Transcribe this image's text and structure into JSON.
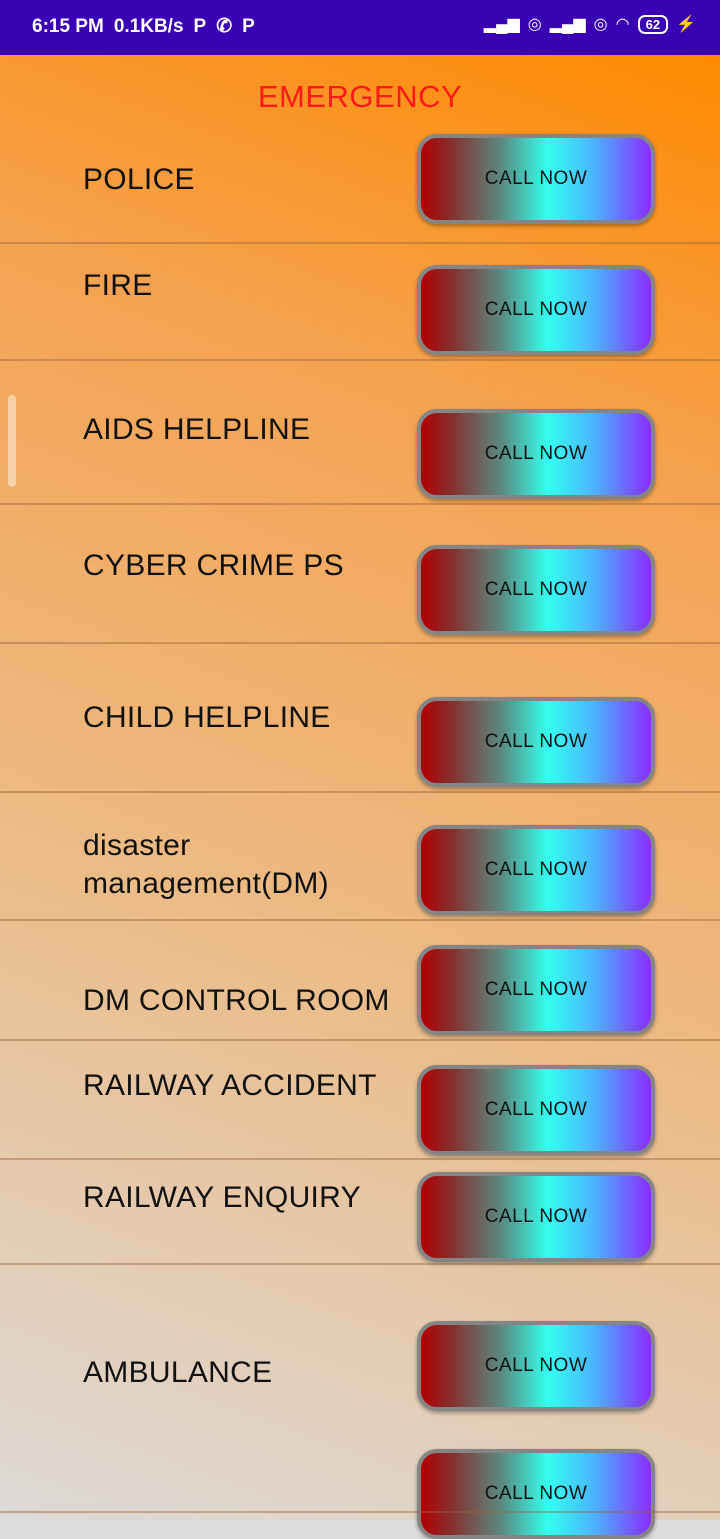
{
  "status_bar": {
    "time": "6:15 PM",
    "speed": "0.1KB/s",
    "battery": "62"
  },
  "page": {
    "title": "EMERGENCY"
  },
  "button_label": "CALL NOW",
  "items": [
    {
      "label": "POLICE"
    },
    {
      "label": "FIRE"
    },
    {
      "label": "AIDS HELPLINE"
    },
    {
      "label": "CYBER CRIME PS"
    },
    {
      "label": "CHILD HELPLINE"
    },
    {
      "label": "disaster"
    },
    {
      "label": "management(DM)"
    },
    {
      "label": "DM CONTROL ROOM"
    },
    {
      "label": "RAILWAY ACCIDENT"
    },
    {
      "label": "RAILWAY ENQUIRY"
    },
    {
      "label": "AMBULANCE"
    }
  ]
}
